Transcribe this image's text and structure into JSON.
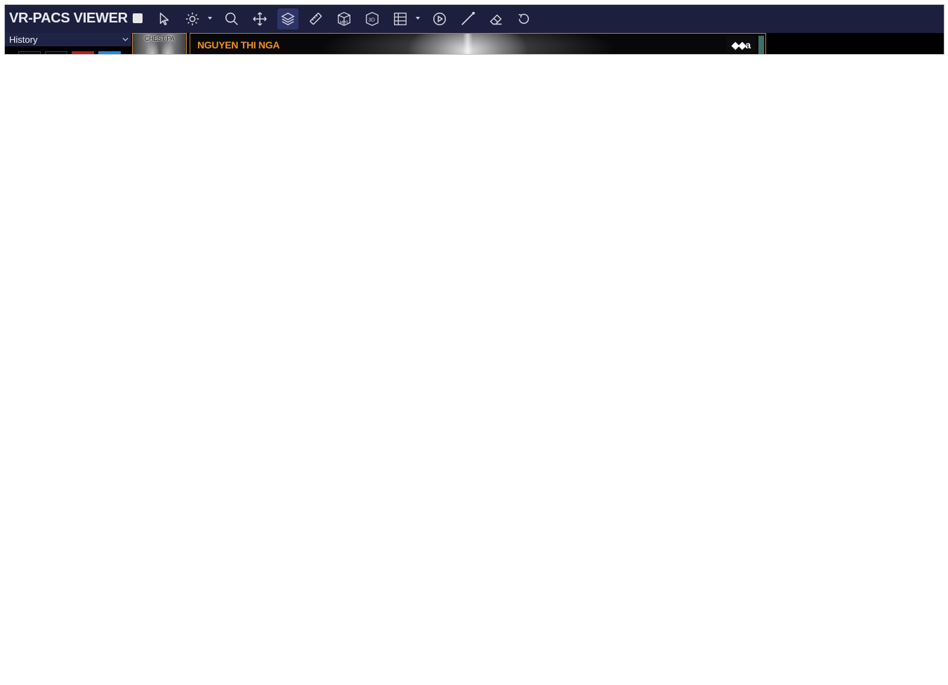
{
  "app": {
    "title": "VR-PACS VIEWER"
  },
  "toolbar": {
    "tools": [
      {
        "name": "stop-icon"
      },
      {
        "name": "pointer-icon"
      },
      {
        "name": "brightness-icon",
        "dropdown": true
      },
      {
        "name": "zoom-icon"
      },
      {
        "name": "pan-icon"
      },
      {
        "name": "stack-icon",
        "active": true
      },
      {
        "name": "ruler-icon"
      },
      {
        "name": "mpr-icon",
        "text": "MPR"
      },
      {
        "name": "3d-icon",
        "text": "3D"
      },
      {
        "name": "layout-icon",
        "dropdown": true
      },
      {
        "name": "play-icon"
      },
      {
        "name": "line-icon"
      },
      {
        "name": "eraser-icon"
      },
      {
        "name": "reset-icon"
      }
    ]
  },
  "sidebar": {
    "history_label": "History",
    "colors": {
      "red": "#b71c1c",
      "blue": "#1e88e5"
    }
  },
  "series": {
    "thumbnail_label": "CHEST PA"
  },
  "viewer": {
    "patient_name": "NGUYEN THI NGA",
    "orientation_marker": "◆◆a",
    "accent_color": "#f0901f"
  }
}
